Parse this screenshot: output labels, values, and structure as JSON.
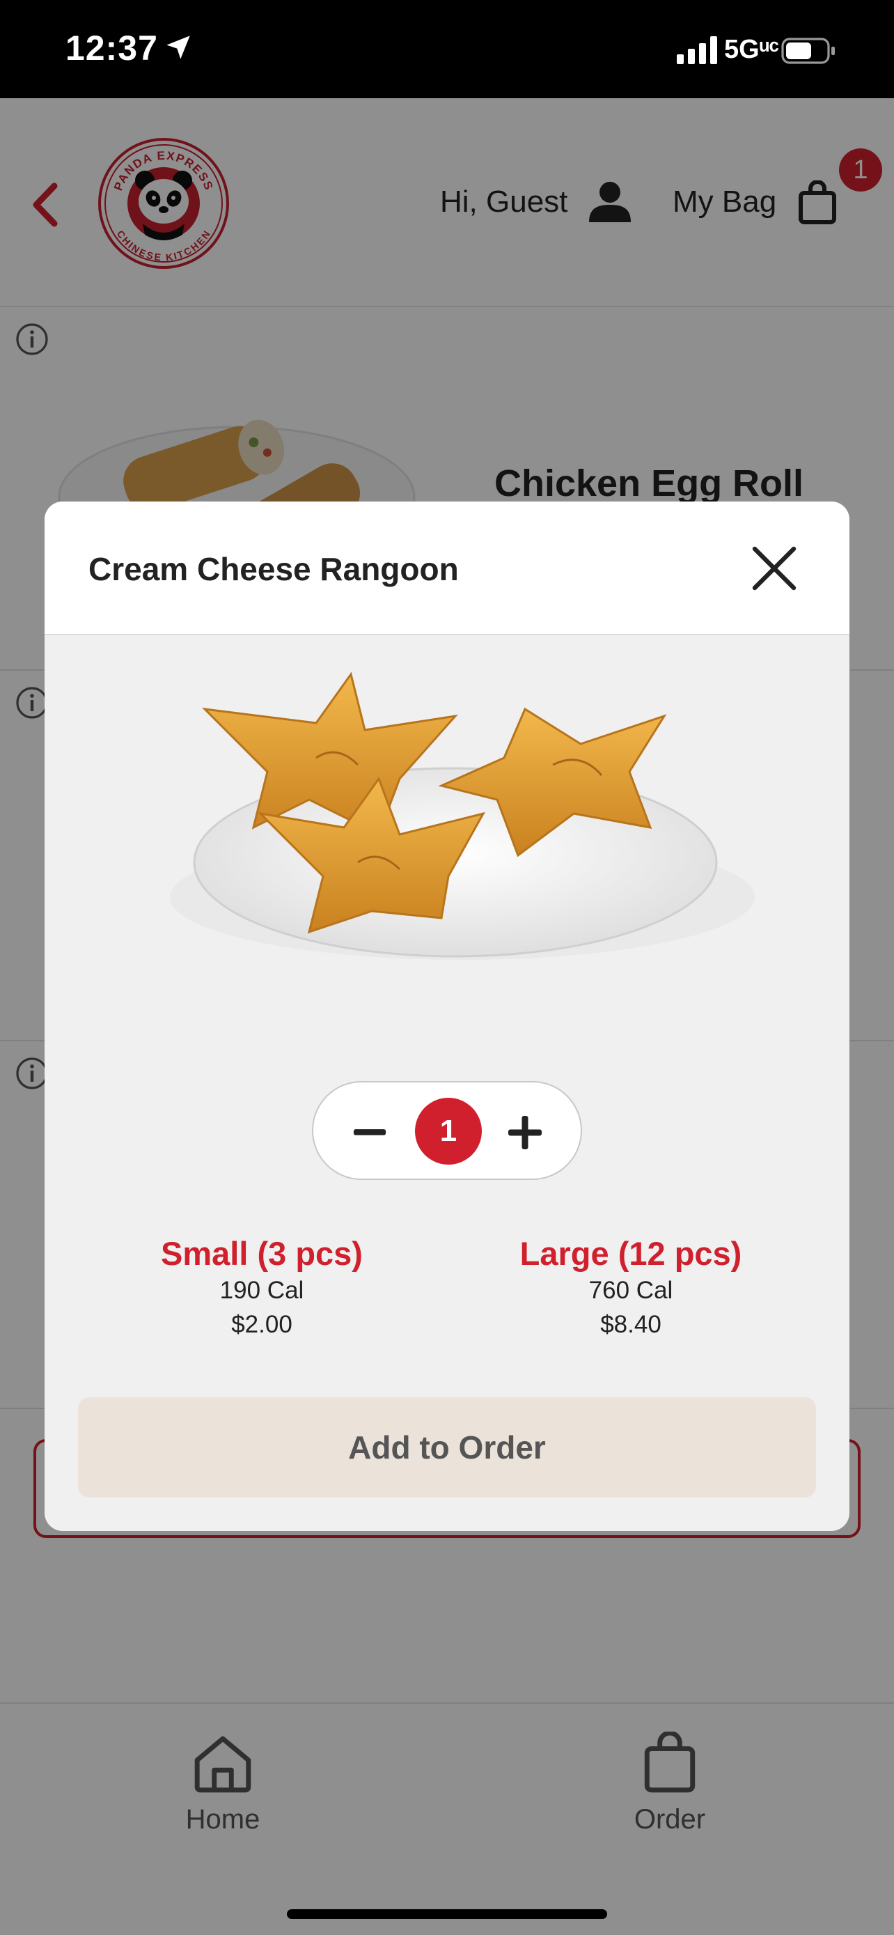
{
  "status_bar": {
    "time": "12:37",
    "network": "5Gᵘᶜ",
    "location_icon": "location-arrow-icon",
    "signal_icon": "cellular-signal-icon",
    "battery_icon": "battery-icon"
  },
  "header": {
    "back_icon": "chevron-left-icon",
    "logo_name": "Panda Express Chinese Kitchen logo",
    "logo_text_top": "PANDA EXPRESS",
    "logo_text_bottom": "CHINESE KITCHEN",
    "greeting": "Hi, Guest",
    "user_icon": "user-icon",
    "bag_label": "My Bag",
    "bag_icon": "shopping-bag-icon",
    "bag_count": "1"
  },
  "menu_items": [
    {
      "title": "Chicken Egg Roll",
      "info_icon": "info-icon"
    },
    {
      "title": "",
      "info_icon": "info-icon"
    },
    {
      "title": "",
      "info_icon": "info-icon"
    }
  ],
  "bottom_nav": {
    "items": [
      {
        "label": "Home",
        "icon": "home-icon"
      },
      {
        "label": "Order",
        "icon": "shopping-bag-icon"
      }
    ]
  },
  "modal": {
    "title": "Cream Cheese Rangoon",
    "close_icon": "close-icon",
    "quantity": "1",
    "minus_icon": "minus-icon",
    "plus_icon": "plus-icon",
    "sizes": [
      {
        "name": "Small (3 pcs)",
        "calories": "190 Cal",
        "price": "$2.00"
      },
      {
        "name": "Large (12 pcs)",
        "calories": "760 Cal",
        "price": "$8.40"
      }
    ],
    "add_button": "Add to Order"
  },
  "colors": {
    "brand_red": "#d0202e",
    "add_button_bg": "#ebe3da",
    "modal_bg": "#f0f0f0"
  }
}
